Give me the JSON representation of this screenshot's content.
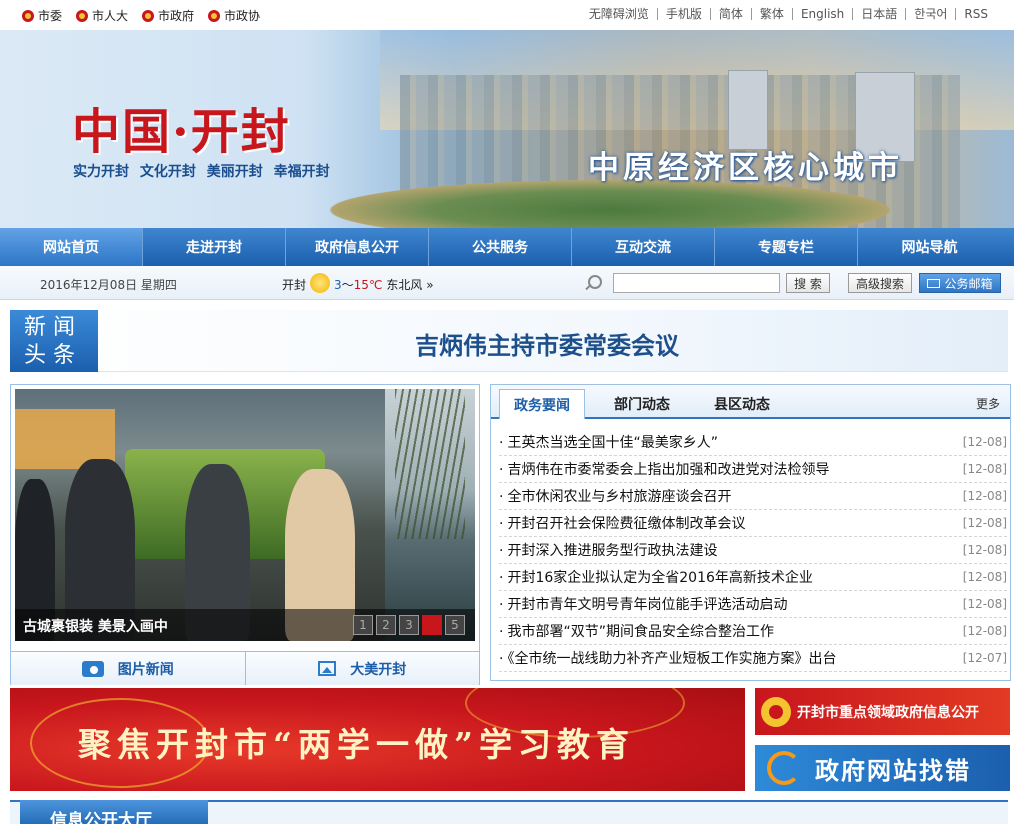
{
  "topbar": {
    "left_links": [
      "市委",
      "市人大",
      "市政府",
      "市政协"
    ],
    "right_links": [
      "无障碍浏览",
      "手机版",
      "简体",
      "繁体",
      "English",
      "日本語",
      "한국어",
      "RSS"
    ]
  },
  "banner": {
    "logo_title": "中国·开封",
    "logo_sub": "实力开封  文化开封  美丽开封  幸福开封",
    "slogan": "中原经济区核心城市"
  },
  "nav": [
    "网站首页",
    "走进开封",
    "政府信息公开",
    "公共服务",
    "互动交流",
    "专题专栏",
    "网站导航"
  ],
  "infobar": {
    "date": "2016年12月08日  星期四",
    "weather_city": "开封",
    "temp_low": "3",
    "temp_sep": "～",
    "temp_high": "15℃",
    "wind": "东北风 »",
    "search_button": "搜 索",
    "advanced_search": "高级搜索",
    "mail_button": "公务邮箱"
  },
  "headline": {
    "tag_line1": "新 闻",
    "tag_line2": "头 条",
    "title": "吉炳伟主持市委常委会议"
  },
  "photo_news": {
    "caption": "古城裹银装 美景入画中",
    "pages": [
      "1",
      "2",
      "3",
      "4",
      "5"
    ],
    "active_page": 4,
    "tab1": "图片新闻",
    "tab2": "大美开封"
  },
  "news": {
    "tabs": [
      "政务要闻",
      "部门动态",
      "县区动态"
    ],
    "more": "更多",
    "items": [
      {
        "title": "王英杰当选全国十佳“最美家乡人”",
        "date": "[12-08]"
      },
      {
        "title": "吉炳伟在市委常委会上指出加强和改进党对法检领导",
        "date": "[12-08]"
      },
      {
        "title": "全市休闲农业与乡村旅游座谈会召开",
        "date": "[12-08]"
      },
      {
        "title": "开封召开社会保险费征缴体制改革会议",
        "date": "[12-08]"
      },
      {
        "title": "开封深入推进服务型行政执法建设",
        "date": "[12-08]"
      },
      {
        "title": "开封16家企业拟认定为全省2016年高新技术企业",
        "date": "[12-08]"
      },
      {
        "title": "开封市青年文明号青年岗位能手评选活动启动",
        "date": "[12-08]"
      },
      {
        "title": "我市部署“双节”期间食品安全综合整治工作",
        "date": "[12-08]"
      },
      {
        "title": "《全市统一战线助力补齐产业短板工作实施方案》出台",
        "date": "[12-07]"
      }
    ]
  },
  "banners": {
    "main": "聚焦开封市“两学一做”学习教育",
    "side1": "开封市重点领域政府信息公开",
    "side2": "政府网站找错"
  },
  "section": {
    "title": "信息公开大厅"
  },
  "colors": {
    "brand_blue": "#1b5fae",
    "brand_red": "#c8161d",
    "gold": "#f4c430"
  }
}
